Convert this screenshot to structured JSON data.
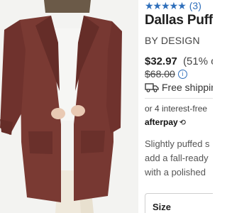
{
  "rating": {
    "stars": "★★★★★",
    "count": "(3)"
  },
  "product": {
    "title": "Dallas Puff",
    "brand": "BY DESIGN",
    "price": "$32.97",
    "discount": "(51% o",
    "original_price": "$68.00",
    "shipping": "Free shippin"
  },
  "payments": {
    "installments": "or 4 interest-free",
    "afterpay_label": "afterpay",
    "afterpay_arrow": "⟲"
  },
  "description": [
    "Slightly puffed s",
    "add a fall-ready",
    "with a polished"
  ],
  "size": {
    "label": "Size"
  },
  "colors": {
    "link": "#2f6fbb",
    "coat": "#7a3a33"
  },
  "icons": {
    "rating": "star-icon",
    "info": "info-icon",
    "shipping": "truck-icon"
  }
}
